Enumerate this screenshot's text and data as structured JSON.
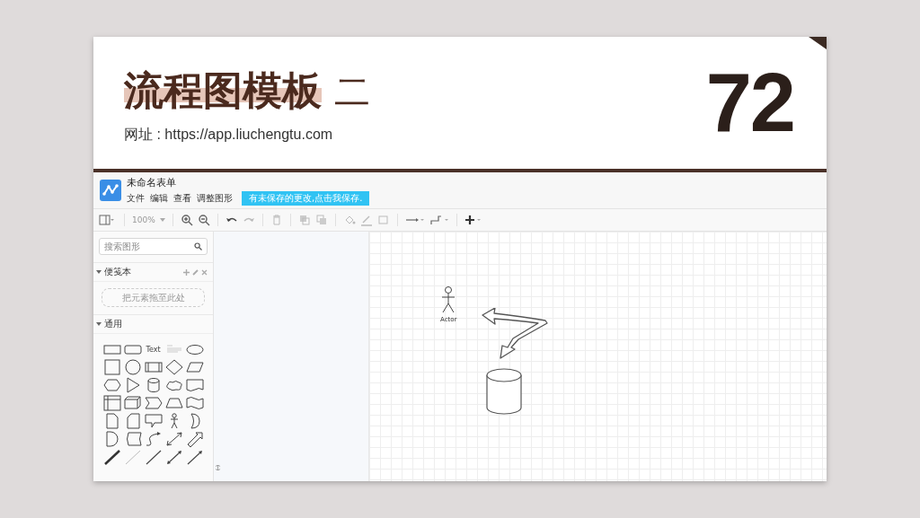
{
  "slide": {
    "title": "流程图模板",
    "title_suffix": "二",
    "url_line": "网址 : https://app.liuchengtu.com",
    "number": "72"
  },
  "app": {
    "doc_title": "未命名表单",
    "menus": [
      "文件",
      "编辑",
      "查看",
      "调整图形"
    ],
    "notice": "有未保存的更改,点击我保存.",
    "toolbar": {
      "zoom": "100%"
    },
    "sidebar": {
      "search": {
        "placeholder": "搜索图形"
      },
      "sections": [
        {
          "title": "便笺本",
          "expanded": true,
          "kind": "scratchpad",
          "drop_hint": "把元素拖至此处"
        },
        {
          "title": "通用",
          "expanded": true,
          "kind": "palette",
          "text_shape_label": "Text"
        }
      ]
    },
    "canvas": {
      "actor_label": "Actor"
    }
  }
}
